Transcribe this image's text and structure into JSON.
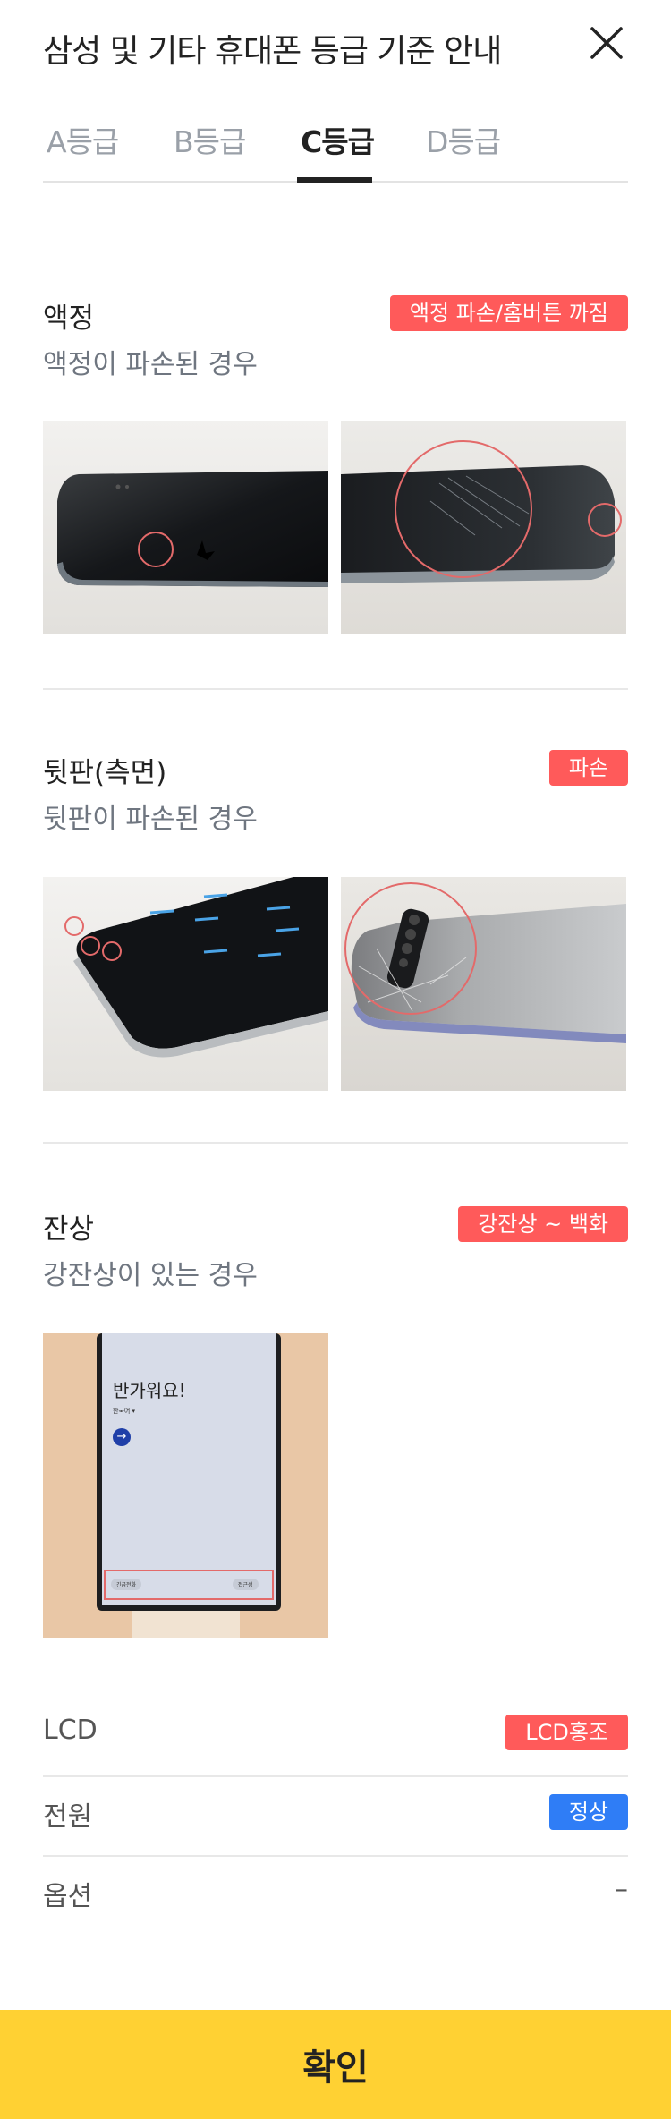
{
  "header": {
    "title": "삼성 및 기타 휴대폰 등급 기준 안내"
  },
  "tabs": [
    {
      "label": "A등급"
    },
    {
      "label": "B등급"
    },
    {
      "label": "C등급",
      "active": true
    },
    {
      "label": "D등급"
    }
  ],
  "sections": [
    {
      "title": "액정",
      "desc": "액정이 파손된 경우",
      "badge": "액정 파손/홈버튼 까짐"
    },
    {
      "title": "뒷판(측면)",
      "desc": "뒷판이 파손된 경우",
      "badge": "파손"
    },
    {
      "title": "잔상",
      "desc": "강잔상이 있는 경우",
      "badge": "강잔상 ~ 백화"
    }
  ],
  "afterimage_photo": {
    "greeting": "반가워요!",
    "language": "한국어 ▾",
    "left_button": "긴급전화",
    "right_button": "접근성"
  },
  "rows": [
    {
      "label": "LCD",
      "value": "LCD홍조",
      "color": "#ff5a5a"
    },
    {
      "label": "전원",
      "value": "정상",
      "color": "#2f7df6"
    },
    {
      "label": "옵션",
      "value": "–"
    }
  ],
  "footer": {
    "confirm_label": "확인"
  },
  "colors": {
    "accent_red": "#ff5a5a",
    "accent_blue": "#2f7df6",
    "confirm_yellow": "#ffd133"
  }
}
